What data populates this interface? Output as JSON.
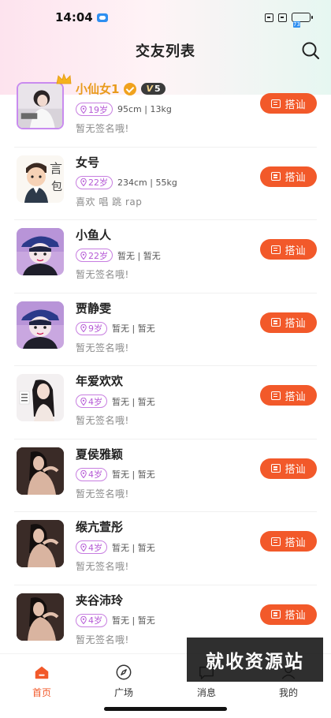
{
  "status_bar": {
    "time": "14:04",
    "battery": "73"
  },
  "header": {
    "title": "交友列表"
  },
  "users": [
    {
      "name": "小仙女1",
      "vip": true,
      "vip_level": "5",
      "age": "19岁",
      "stats": "95cm | 13kg",
      "signature": "暂无签名哦!",
      "avatar": "photo-girl"
    },
    {
      "name": "女号",
      "vip": false,
      "age": "22岁",
      "stats": "234cm | 55kg",
      "signature": "喜欢 唱 跳 rap",
      "avatar": "cartoon-boy"
    },
    {
      "name": "小鱼人",
      "vip": false,
      "age": "22岁",
      "stats": "暂无 | 暂无",
      "signature": "暂无签名哦!",
      "avatar": "anime-cap"
    },
    {
      "name": "贾静雯",
      "vip": false,
      "age": "9岁",
      "stats": "暂无 | 暂无",
      "signature": "暂无签名哦!",
      "avatar": "anime-cap"
    },
    {
      "name": "年爱欢欢",
      "vip": false,
      "age": "4岁",
      "stats": "暂无 | 暂无",
      "signature": "暂无签名哦!",
      "avatar": "illustration-girl"
    },
    {
      "name": "夏侯雅颖",
      "vip": false,
      "age": "4岁",
      "stats": "暂无 | 暂无",
      "signature": "暂无签名哦!",
      "avatar": "photo-dark"
    },
    {
      "name": "缑亢萱彤",
      "vip": false,
      "age": "4岁",
      "stats": "暂无 | 暂无",
      "signature": "暂无签名哦!",
      "avatar": "photo-dark"
    },
    {
      "name": "夹谷沛玲",
      "vip": false,
      "age": "4岁",
      "stats": "暂无 | 暂无",
      "signature": "暂无签名哦!",
      "avatar": "photo-dark"
    }
  ],
  "chat_label": "搭讪",
  "tabbar": {
    "tabs": [
      {
        "label": "首页",
        "icon": "home-icon",
        "active": true
      },
      {
        "label": "广场",
        "icon": "compass-icon",
        "active": false
      },
      {
        "label": "消息",
        "icon": "message-icon",
        "active": false
      },
      {
        "label": "我的",
        "icon": "user-icon",
        "active": false
      }
    ]
  },
  "watermark": "就收资源站",
  "colors": {
    "accent": "#f2592a",
    "vip_name": "#e89b1c",
    "age_badge": "#b65ad6"
  }
}
